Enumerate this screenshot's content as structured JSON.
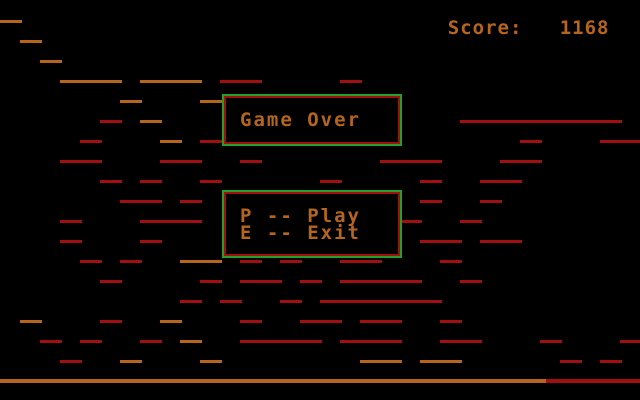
{
  "game": {
    "score_label": "Score:",
    "score_value": "1168",
    "dialog_title": "Game Over",
    "option_play": "P -- Play",
    "option_exit": "E -- Exit"
  },
  "colors": {
    "background": "#000000",
    "orange": "#b5651d",
    "red": "#a01010",
    "dialog_border": "#22a02a"
  }
}
